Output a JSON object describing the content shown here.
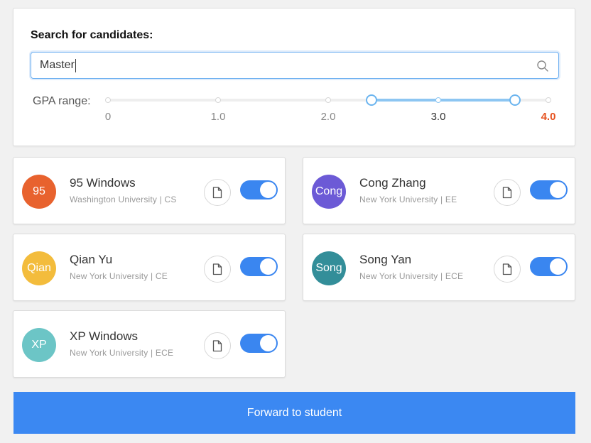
{
  "search": {
    "title": "Search for candidates:",
    "query": "Master",
    "icon": "search-icon"
  },
  "gpa": {
    "label": "GPA range:",
    "ticks": [
      "0",
      "1.0",
      "2.0",
      "3.0",
      "4.0"
    ],
    "range_low": 2.4,
    "range_high": 3.7,
    "range_color": "#8dc6f2",
    "highlight_color": "#e6521f"
  },
  "candidates": [
    {
      "initials": "95",
      "name": "95 Windows",
      "meta": "Washington University | CS",
      "color": "#e8622e",
      "selected": true
    },
    {
      "initials": "Cong",
      "name": "Cong Zhang",
      "meta": "New York University | EE",
      "color": "#6c5ad6",
      "selected": true
    },
    {
      "initials": "Qian",
      "name": "Qian Yu",
      "meta": "New York University | CE",
      "color": "#f3bc3c",
      "selected": true
    },
    {
      "initials": "Song",
      "name": "Song Yan",
      "meta": "New York University | ECE",
      "color": "#338e99",
      "selected": true
    },
    {
      "initials": "XP",
      "name": "XP Windows",
      "meta": "New York University | ECE",
      "color": "#6cc5c6",
      "selected": true
    }
  ],
  "colors": {
    "toggle_on": "#3a86f0",
    "primary": "#3b88f2"
  },
  "actions": {
    "forward_label": "Forward to student"
  }
}
